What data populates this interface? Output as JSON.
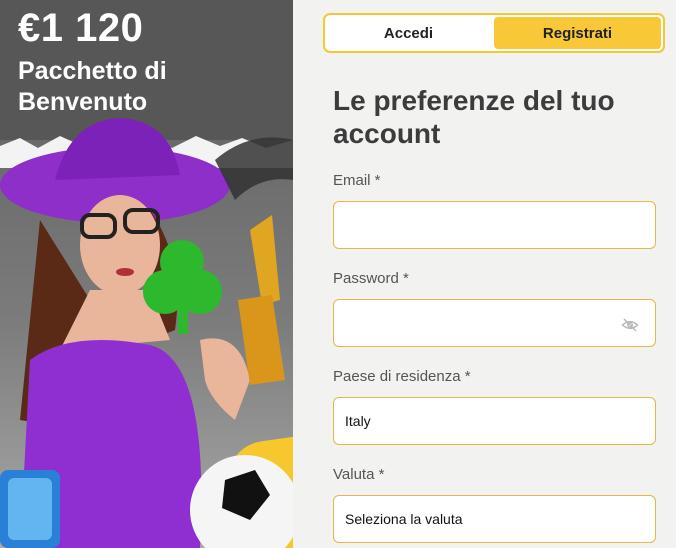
{
  "promo": {
    "amount": "€1 120",
    "subtitle": "Pacchetto di Benvenuto"
  },
  "tabs": {
    "login": "Accedi",
    "register": "Registrati"
  },
  "heading": "Le preferenze del tuo account",
  "fields": {
    "email_label": "Email *",
    "email_value": "",
    "password_label": "Password *",
    "password_value": "",
    "country_label": "Paese di residenza *",
    "country_value": "Italy",
    "currency_label": "Valuta *",
    "currency_value": "Seleziona la valuta"
  },
  "icons": {
    "password_toggle": "eye-off-icon"
  },
  "colors": {
    "accent": "#f8c838",
    "field_border": "#e3b74a",
    "promo_bg": "#575757"
  }
}
